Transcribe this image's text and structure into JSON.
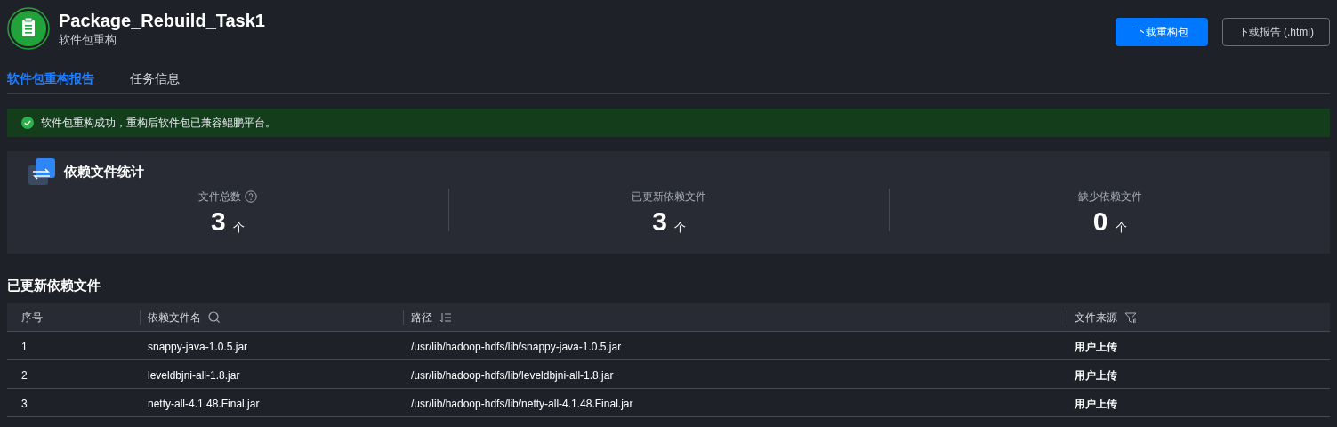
{
  "header": {
    "title": "Package_Rebuild_Task1",
    "subtitle": "软件包重构"
  },
  "buttons": [
    {
      "label": "下载重构包",
      "kind": "primary"
    },
    {
      "label": "下载报告 (.html)",
      "kind": "outline"
    }
  ],
  "tabs": [
    {
      "label": "软件包重构报告",
      "selected": true
    },
    {
      "label": "任务信息",
      "selected": false
    }
  ],
  "alert": {
    "kind": "success",
    "text": "软件包重构成功，重构后软件包已兼容鲲鹏平台。"
  },
  "stats": {
    "title": "依赖文件统计",
    "items": [
      {
        "label": "文件总数",
        "value": "3",
        "unit": "个",
        "help": true
      },
      {
        "label": "已更新依赖文件",
        "value": "3",
        "unit": "个",
        "help": false
      },
      {
        "label": "缺少依赖文件",
        "value": "0",
        "unit": "个",
        "help": false
      }
    ]
  },
  "table": {
    "title": "已更新依赖文件",
    "columns": [
      {
        "label": "序号",
        "kind": "plain"
      },
      {
        "label": "依赖文件名",
        "kind": "search"
      },
      {
        "label": "路径",
        "kind": "sort"
      },
      {
        "label": "文件来源",
        "kind": "filter"
      }
    ],
    "rows": [
      [
        "1",
        "snappy-java-1.0.5.jar",
        "/usr/lib/hadoop-hdfs/lib/snappy-java-1.0.5.jar",
        "用户上传"
      ],
      [
        "2",
        "leveldbjni-all-1.8.jar",
        "/usr/lib/hadoop-hdfs/lib/leveldbjni-all-1.8.jar",
        "用户上传"
      ],
      [
        "3",
        "netty-all-4.1.48.Final.jar",
        "/usr/lib/hadoop-hdfs/lib/netty-all-4.1.48.Final.jar",
        "用户上传"
      ]
    ]
  }
}
